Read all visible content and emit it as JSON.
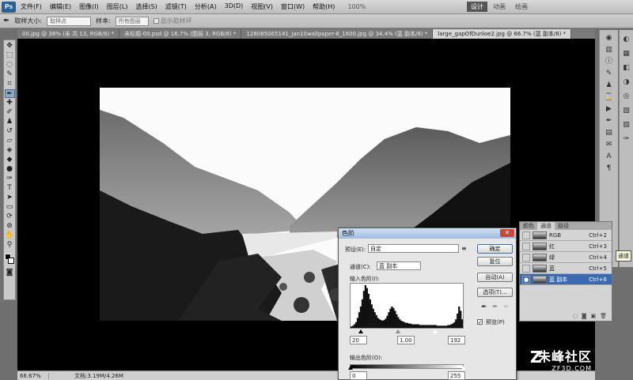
{
  "app": {
    "logo": "Ps"
  },
  "menu": [
    "文件(F)",
    "编辑(E)",
    "图像(I)",
    "图层(L)",
    "选择(S)",
    "滤镜(T)",
    "分析(A)",
    "3D(D)",
    "视图(V)",
    "窗口(W)",
    "帮助(H)"
  ],
  "menu_zoom": "100%",
  "workspaces": [
    "设计",
    "动画",
    "绘画"
  ],
  "active_workspace": "设计",
  "options": {
    "sample_size_label": "取样大小:",
    "sample_size_value": "取样点",
    "sample_label": "样本:",
    "sample_value": "所有图层",
    "show_ring_label": "显示取样环"
  },
  "tabs": [
    "00.jpg @ 38% (未 共 13, RGB/8) *",
    "未标题-00.psd @ 16.7% (图层 3, RGB/8) *",
    "128085065141_jan10wallpaper-8_1600.jpg @ 34.4% (蓝 副本/8) *",
    "large_gapOfDunloe2.jpg @ 66.7% (蓝 副本/8) *"
  ],
  "active_tab": 3,
  "status": {
    "zoom": "66.67%",
    "doc": "文档:3.19M/4.26M"
  },
  "tooltip": "通道",
  "channels_panel": {
    "tabs": [
      "颜色",
      "通道",
      "路径"
    ],
    "active_tab": "通道",
    "rows": [
      {
        "name": "RGB",
        "key": "Ctrl+2",
        "visible": false,
        "selected": false
      },
      {
        "name": "红",
        "key": "Ctrl+3",
        "visible": false,
        "selected": false
      },
      {
        "name": "绿",
        "key": "Ctrl+4",
        "visible": false,
        "selected": false
      },
      {
        "name": "蓝",
        "key": "Ctrl+5",
        "visible": false,
        "selected": false
      },
      {
        "name": "蓝 副本",
        "key": "Ctrl+6",
        "visible": true,
        "selected": true
      }
    ]
  },
  "levels_dialog": {
    "title": "色阶",
    "preset_label": "预设(E):",
    "preset_value": "自定",
    "channel_label": "通道(C):",
    "channel_value": "蓝 副本",
    "input_label": "输入色阶(I):",
    "output_label": "输出色阶(O):",
    "input_black": "20",
    "input_gamma": "1.00",
    "input_white": "192",
    "output_black": "0",
    "output_white": "255",
    "buttons": {
      "ok": "确定",
      "reset": "复位",
      "auto": "自动(A)",
      "options": "选项(T)..."
    },
    "preview_label": "预览(P)",
    "preview_checked": true,
    "histogram": [
      2,
      3,
      5,
      8,
      14,
      22,
      30,
      40,
      52,
      60,
      56,
      48,
      40,
      33,
      27,
      22,
      18,
      14,
      12,
      11,
      10,
      11,
      13,
      17,
      22,
      27,
      30,
      28,
      24,
      19,
      15,
      12,
      10,
      9,
      8,
      7,
      7,
      6,
      6,
      5,
      5,
      5,
      5,
      5,
      4,
      4,
      4,
      4,
      4,
      4,
      4,
      4,
      4,
      4,
      4,
      3,
      3,
      3,
      3,
      3,
      3,
      3,
      4,
      4,
      5,
      6,
      8,
      12,
      20,
      30,
      24,
      12
    ]
  },
  "watermark": {
    "brand": "朱峰社区",
    "url": "ZF3D.COM"
  }
}
